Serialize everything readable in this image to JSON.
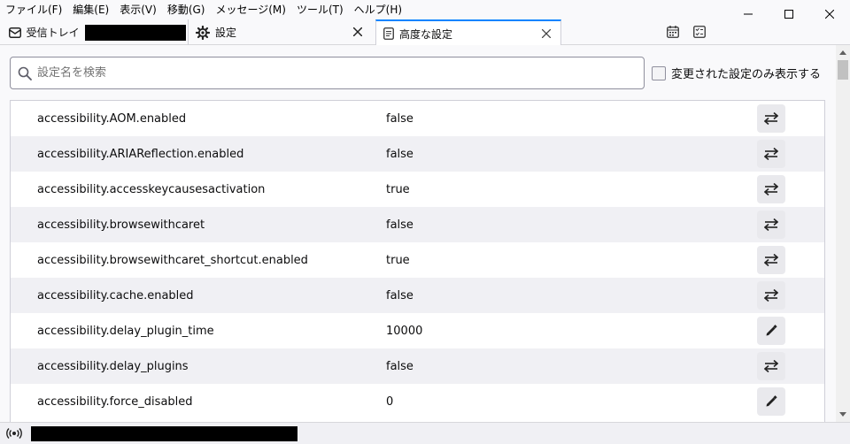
{
  "menubar": {
    "items": [
      "ファイル(F)",
      "編集(E)",
      "表示(V)",
      "移動(G)",
      "メッセージ(M)",
      "ツール(T)",
      "ヘルプ(H)"
    ]
  },
  "window_controls": {
    "minimize": "—",
    "maximize": "☐",
    "close": "✕"
  },
  "tabs": [
    {
      "label": "受信トレイ",
      "icon": "envelope-icon"
    },
    {
      "label": "設定",
      "icon": "gear-icon"
    },
    {
      "label": "高度な設定",
      "icon": "document-icon",
      "active": true
    }
  ],
  "toolbar_icons": [
    "calendar-icon",
    "tasks-icon"
  ],
  "search": {
    "placeholder": "設定名を検索",
    "value": ""
  },
  "show_modified": {
    "label": "変更された設定のみ表示する",
    "checked": false
  },
  "prefs": [
    {
      "name": "accessibility.AOM.enabled",
      "value": "false",
      "action": "toggle"
    },
    {
      "name": "accessibility.ARIAReflection.enabled",
      "value": "false",
      "action": "toggle"
    },
    {
      "name": "accessibility.accesskeycausesactivation",
      "value": "true",
      "action": "toggle"
    },
    {
      "name": "accessibility.browsewithcaret",
      "value": "false",
      "action": "toggle"
    },
    {
      "name": "accessibility.browsewithcaret_shortcut.enabled",
      "value": "true",
      "action": "toggle"
    },
    {
      "name": "accessibility.cache.enabled",
      "value": "false",
      "action": "toggle"
    },
    {
      "name": "accessibility.delay_plugin_time",
      "value": "10000",
      "action": "edit"
    },
    {
      "name": "accessibility.delay_plugins",
      "value": "false",
      "action": "toggle"
    },
    {
      "name": "accessibility.force_disabled",
      "value": "0",
      "action": "edit"
    }
  ],
  "colors": {
    "accent": "#0a84ff",
    "row_alt": "#f0f0f4"
  }
}
